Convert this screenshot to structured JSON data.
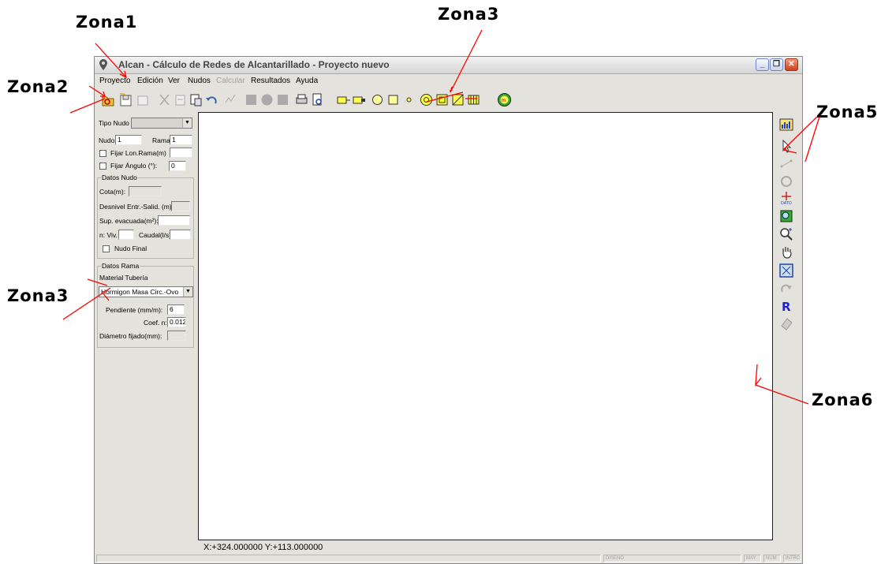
{
  "zone_labels": {
    "zona1": "Zona1",
    "zona2": "Zona2",
    "zona3_top": "Zona3",
    "zona3_left": "Zona3",
    "zona5": "Zona5",
    "zona6": "Zona6"
  },
  "window": {
    "title": "Alcan - Cálculo de Redes de Alcantarillado - Proyecto nuevo",
    "controls": [
      "minimize-icon",
      "restore-icon",
      "close-icon"
    ]
  },
  "menu": [
    {
      "label": "Proyecto",
      "enabled": true
    },
    {
      "label": "Edición",
      "enabled": true
    },
    {
      "label": "Ver",
      "enabled": true
    },
    {
      "label": "Nudos",
      "enabled": true
    },
    {
      "label": "Calcular",
      "enabled": false
    },
    {
      "label": "Resultados",
      "enabled": true
    },
    {
      "label": "Ayuda",
      "enabled": true
    }
  ],
  "toolbar_icons": [
    "open-folder-icon",
    "save-icon",
    "copy-icon",
    "cut-icon",
    "paste-icon",
    "paste-special-icon",
    "undo-icon",
    "calc-icon",
    "block-icon",
    "node-circle-icon",
    "block2-icon",
    "print-icon",
    "print-preview-icon",
    "node-tool-1-icon",
    "node-tool-2-icon",
    "circle-node-icon",
    "square-node-icon",
    "dot-node-icon",
    "target-node-icon",
    "box-node-icon",
    "diagonal-node-icon",
    "grid-node-icon",
    "meter-icon"
  ],
  "left_panel": {
    "tipo_nudo_label": "Tipo Nudo",
    "tipo_nudo_value": "",
    "nudo_label": "Nudo",
    "nudo_value": "1",
    "rama_label": "Rama",
    "rama_value": "1",
    "fijar_lon_label": "Fijar Lon.Rama(m)",
    "fijar_lon_value": "",
    "fijar_angulo_label": "Fijar Ángulo (°):",
    "fijar_angulo_value": "0",
    "datos_nudo": {
      "title": "Datos Nudo",
      "cota_label": "Cota(m):",
      "desnivel_label": "Desnivel Entr.-Salid. (m):",
      "sup_label": "Sup. evacuada(m²):",
      "viv_label": "n: Viv.",
      "caudal_label": "Caudal(l/s)",
      "nudo_final_label": "Nudo Final"
    },
    "datos_rama": {
      "title": "Datos Rama",
      "material_label": "Material Tubería",
      "material_value": "Hormigon Masa Circ.-Ovo",
      "pendiente_label": "Pendiente (mm/m):",
      "pendiente_value": "6",
      "coef_label": "Coef. n:",
      "coef_value": "0.012",
      "diametro_label": "Diámetro fijado(mm):"
    }
  },
  "coordinates": "X:+324.000000 Y:+113.000000",
  "status": {
    "mode": "DISEÑO",
    "indicators": [
      "MAY",
      "NUM",
      "INTRO"
    ]
  },
  "right_tools": [
    "bar-chart-icon",
    "pointer-icon",
    "distance-icon",
    "settings-disabled-icon",
    "dato-icon",
    "zoom-window-icon",
    "zoom-magnifier-icon",
    "hand-pan-icon",
    "zoom-extents-icon",
    "redo-icon",
    "r-icon",
    "eraser-icon"
  ]
}
